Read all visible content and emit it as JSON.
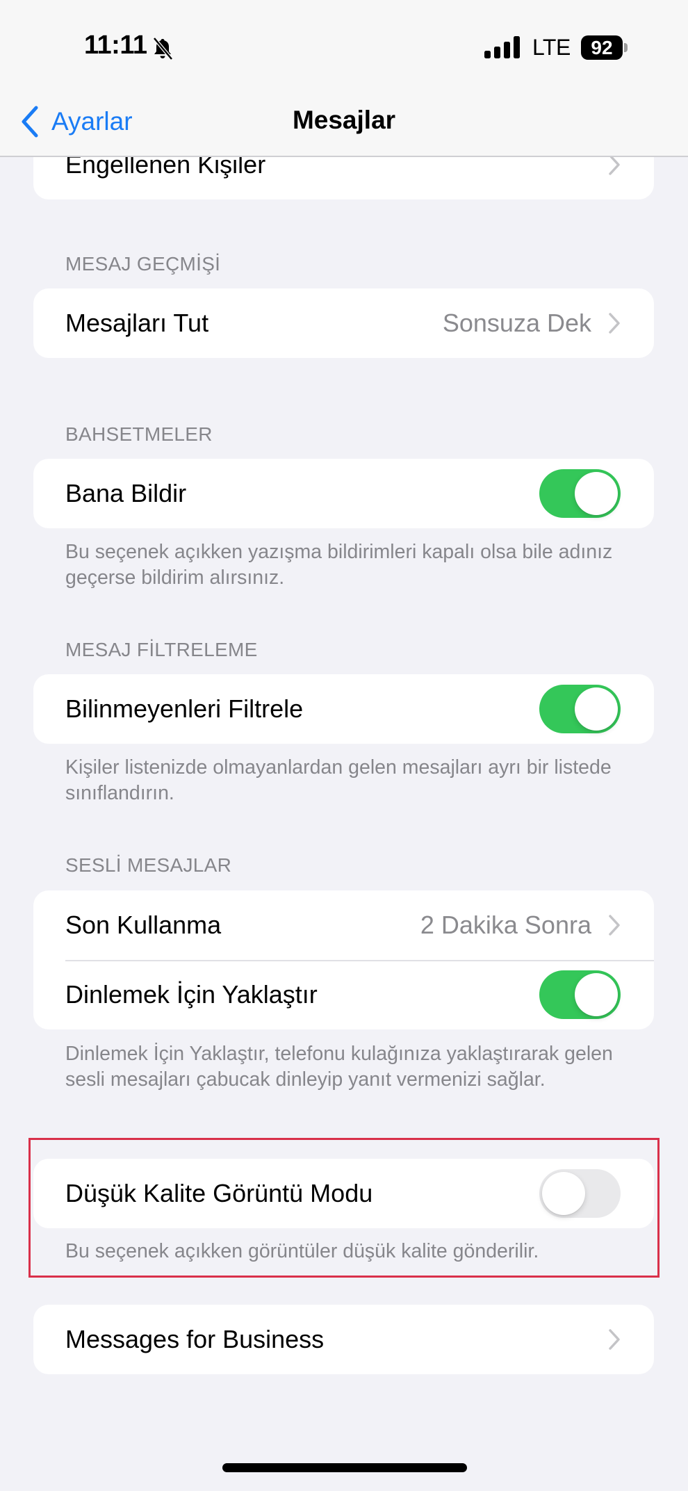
{
  "status_bar": {
    "time": "11:11",
    "silent_icon": "bell-slash-icon",
    "signal_icon": "cellular-signal-icon",
    "network": "LTE",
    "battery_percent": "92"
  },
  "nav": {
    "back_label": "Ayarlar",
    "back_icon": "chevron-left-icon",
    "title": "Mesajlar"
  },
  "colors": {
    "accent": "#1a7cf5",
    "toggle_on": "#34c759",
    "toggle_off": "#e9e9eb",
    "highlight_border": "#d9304a",
    "background": "#f2f2f7"
  },
  "sections": {
    "blocked": {
      "rows": [
        {
          "label": "Engellenen Kişiler",
          "type": "disclosure"
        }
      ]
    },
    "history": {
      "header": "MESAJ GEÇMİŞİ",
      "rows": [
        {
          "label": "Mesajları Tut",
          "value": "Sonsuza Dek",
          "type": "disclosure"
        }
      ]
    },
    "mentions": {
      "header": "BAHSETMELER",
      "rows": [
        {
          "label": "Bana Bildir",
          "type": "toggle",
          "on": true
        }
      ],
      "footer": "Bu seçenek açıkken yazışma bildirimleri kapalı olsa bile adınız geçerse bildirim alırsınız."
    },
    "filtering": {
      "header": "MESAJ FİLTRELEME",
      "rows": [
        {
          "label": "Bilinmeyenleri Filtrele",
          "type": "toggle",
          "on": true
        }
      ],
      "footer": "Kişiler listenizde olmayanlardan gelen mesajları ayrı bir listede sınıflandırın."
    },
    "audio": {
      "header": "SESLİ MESAJLAR",
      "rows": [
        {
          "label": "Son Kullanma",
          "value": "2 Dakika Sonra",
          "type": "disclosure"
        },
        {
          "label": "Dinlemek İçin Yaklaştır",
          "type": "toggle",
          "on": true
        }
      ],
      "footer": "Dinlemek İçin Yaklaştır, telefonu kulağınıza yaklaştırarak gelen sesli mesajları çabucak dinleyip yanıt vermenizi sağlar."
    },
    "low_quality": {
      "rows": [
        {
          "label": "Düşük Kalite Görüntü Modu",
          "type": "toggle",
          "on": false
        }
      ],
      "footer": "Bu seçenek açıkken görüntüler düşük kalite gönderilir.",
      "highlighted": true
    },
    "business": {
      "rows": [
        {
          "label": "Messages for Business",
          "type": "disclosure"
        }
      ]
    }
  }
}
